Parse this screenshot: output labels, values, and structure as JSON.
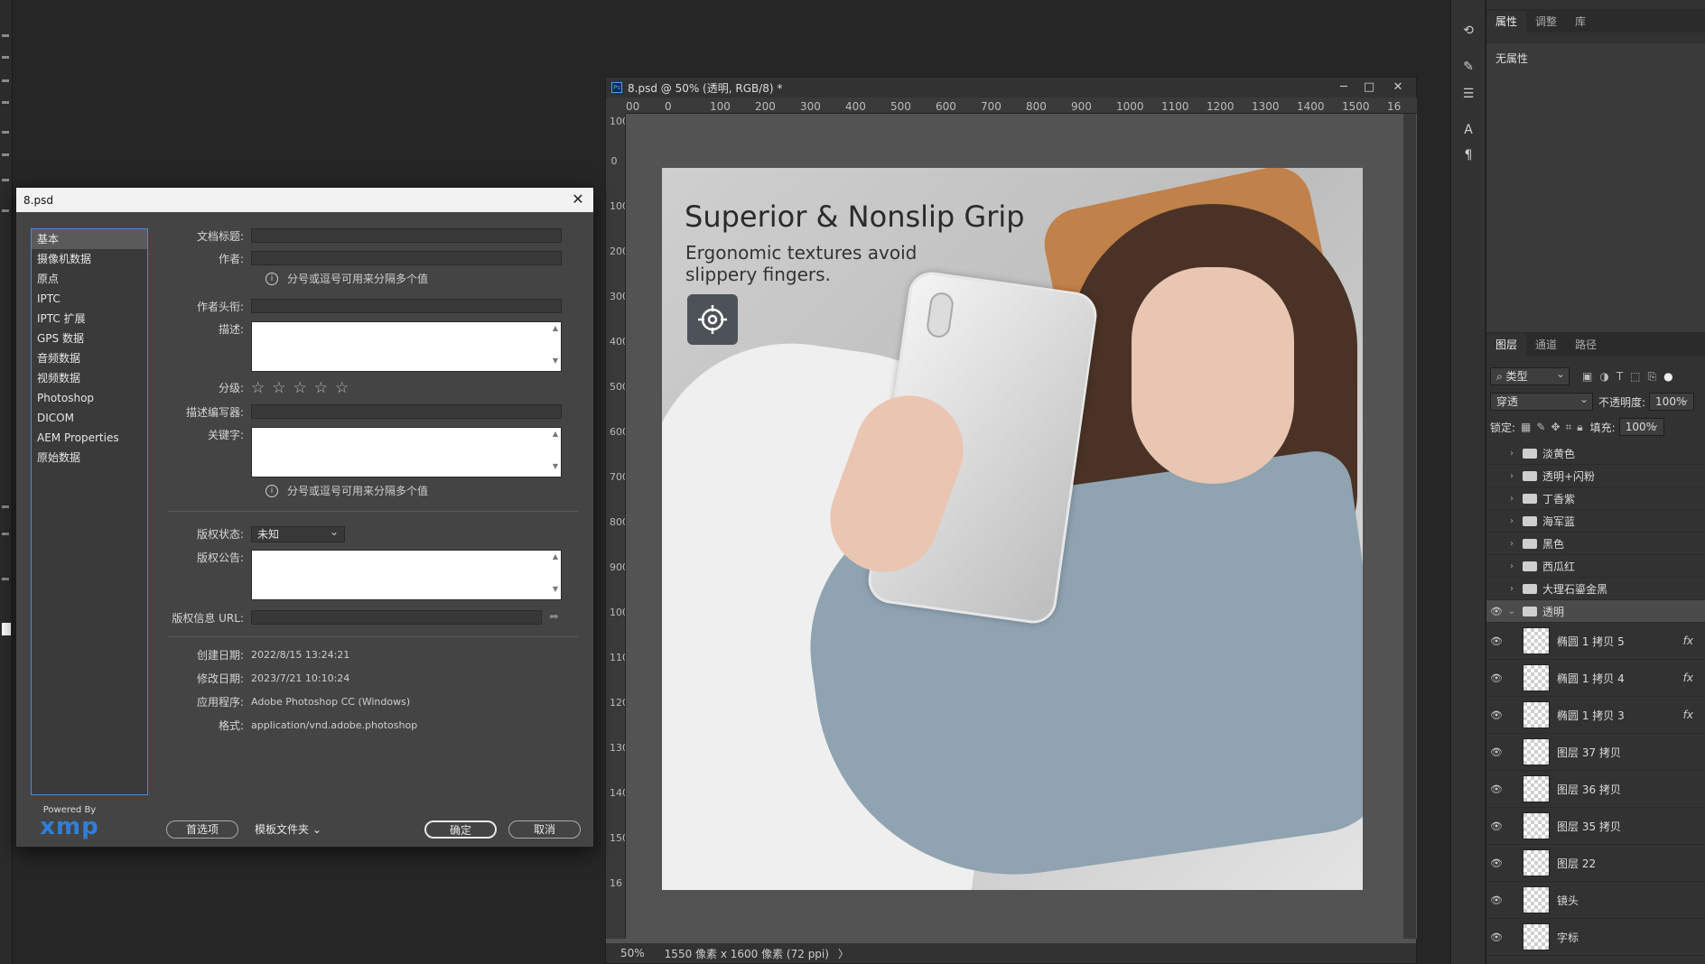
{
  "document": {
    "title": "8.psd @ 50% (透明, RGB/8) *",
    "ps_badge": "Ps",
    "win_minimize": "─",
    "win_restore": "□",
    "win_close": "✕",
    "ruler_h": [
      "00",
      "0",
      "100",
      "200",
      "300",
      "400",
      "500",
      "600",
      "700",
      "800",
      "900",
      "1000",
      "1100",
      "1200",
      "1300",
      "1400",
      "1500",
      "16"
    ],
    "ruler_v": [
      "100",
      "0",
      "100",
      "200",
      "300",
      "400",
      "500",
      "600",
      "700",
      "800",
      "900",
      "1000",
      "1100",
      "1200",
      "1300",
      "1400",
      "1500",
      "16"
    ],
    "zoom": "50%",
    "size_info": "1550 像素 x 1600 像素 (72 ppi)",
    "status_arrow": "〉"
  },
  "artwork": {
    "headline": "Superior & Nonslip Grip",
    "subline": "Ergonomic textures avoid slippery fingers."
  },
  "right_icons": [
    "history-icon",
    "brush-settings-icon",
    "adjust-sliders-icon",
    "character-icon",
    "paragraph-icon"
  ],
  "properties": {
    "tabs": [
      "属性",
      "调整",
      "库"
    ],
    "empty_text": "无属性"
  },
  "layers": {
    "tabs": [
      "图层",
      "通道",
      "路径"
    ],
    "filter_label": "类型",
    "blend_mode": "穿透",
    "opacity_label": "不透明度:",
    "opacity_value": "100%",
    "lock_label": "锁定:",
    "fill_label": "填充:",
    "fill_value": "100%",
    "items": [
      {
        "name": "淡黄色",
        "type": "group",
        "visible": false,
        "selected": false
      },
      {
        "name": "透明+闪粉",
        "type": "group",
        "visible": false,
        "selected": false
      },
      {
        "name": "丁香紫",
        "type": "group",
        "visible": false,
        "selected": false
      },
      {
        "name": "海军蓝",
        "type": "group",
        "visible": false,
        "selected": false
      },
      {
        "name": "黑色",
        "type": "group",
        "visible": false,
        "selected": false
      },
      {
        "name": "西瓜红",
        "type": "group",
        "visible": false,
        "selected": false
      },
      {
        "name": "大理石鎏金黑",
        "type": "group",
        "visible": false,
        "selected": false
      },
      {
        "name": "透明",
        "type": "group-open",
        "visible": true,
        "selected": true
      },
      {
        "name": "椭圆 1 拷贝 5",
        "type": "layer",
        "visible": true,
        "fx": "fx"
      },
      {
        "name": "椭圆 1 拷贝 4",
        "type": "layer",
        "visible": true,
        "fx": "fx"
      },
      {
        "name": "椭圆 1 拷贝 3",
        "type": "layer",
        "visible": true,
        "fx": "fx"
      },
      {
        "name": "图层 37 拷贝",
        "type": "layer",
        "visible": true,
        "fx": ""
      },
      {
        "name": "图层 36 拷贝",
        "type": "layer",
        "visible": true,
        "fx": ""
      },
      {
        "name": "图层 35 拷贝",
        "type": "layer",
        "visible": true,
        "fx": ""
      },
      {
        "name": "图层 22",
        "type": "layer",
        "visible": true,
        "fx": ""
      },
      {
        "name": "镜头",
        "type": "layer",
        "visible": true,
        "fx": ""
      },
      {
        "name": "字标",
        "type": "layer",
        "visible": true,
        "fx": ""
      }
    ]
  },
  "dialog": {
    "title": "8.psd",
    "close": "✕",
    "nav": [
      "基本",
      "摄像机数据",
      "原点",
      "IPTC",
      "IPTC 扩展",
      "GPS 数据",
      "音频数据",
      "视频数据",
      "Photoshop",
      "DICOM",
      "AEM Properties",
      "原始数据"
    ],
    "fields": {
      "doc_title_label": "文档标题:",
      "author_label": "作者:",
      "hint1": "分号或逗号可用来分隔多个值",
      "author_title_label": "作者头衔:",
      "desc_label": "描述:",
      "rating_label": "分级:",
      "desc_writer_label": "描述编写器:",
      "keywords_label": "关键字:",
      "hint2": "分号或逗号可用来分隔多个值",
      "copyright_status_label": "版权状态:",
      "copyright_status_value": "未知",
      "copyright_notice_label": "版权公告:",
      "copyright_url_label": "版权信息 URL:",
      "created_label": "创建日期:",
      "created_value": "2022/8/15 13:24:21",
      "modified_label": "修改日期:",
      "modified_value": "2023/7/21 10:10:24",
      "app_label": "应用程序:",
      "app_value": "Adobe Photoshop CC (Windows)",
      "format_label": "格式:",
      "format_value": "application/vnd.adobe.photoshop",
      "info_i": "i",
      "stars": [
        "☆",
        "☆",
        "☆",
        "☆",
        "☆"
      ]
    },
    "xmp_powered": "Powered By",
    "xmp_word": "xmp",
    "buttons": {
      "prefs": "首选项",
      "templates": "模板文件夹",
      "ok": "确定",
      "cancel": "取消"
    }
  }
}
